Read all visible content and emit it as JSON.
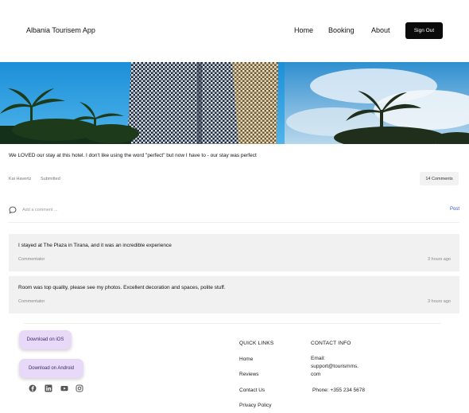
{
  "header": {
    "brand": "Albania Tourisem App",
    "nav": [
      "Home",
      "Booking",
      "About"
    ],
    "sign_out": "Sign Out"
  },
  "review": {
    "text": "We LOVED our stay at this hotel. I don't like using the word \"perfect\" but now I have to - our stay was perfect",
    "author": "Kai Havertz",
    "status": "Submitted",
    "comments_count": "14 Comments"
  },
  "comment_box": {
    "placeholder": "Add a comment ...",
    "post_label": "Post"
  },
  "comments": [
    {
      "body": "I stayed at The Plaza in Tirana, and it was an incredible experience",
      "author": "Commentator",
      "time": "3 hours ago"
    },
    {
      "body": "Room was top quality, please see my photos. Excellent decoration and spaces, polite stuff.",
      "author": "Commentator",
      "time": "3 hours ago"
    }
  ],
  "footer": {
    "ios_button": "Download on iOS",
    "android_button": "Download on  Android",
    "social_icons": [
      "facebook-icon",
      "linkedin-icon",
      "youtube-icon",
      "instagram-icon"
    ],
    "quick_links_title": "QUICK LINKS",
    "quick_links": [
      "Home",
      "Reviews",
      "Contact Us",
      "Privacy Policy"
    ],
    "contact_title": "CONTACT INFO",
    "email_line1": "Email:",
    "email_line2": "support@tourismms.",
    "email_line3": "com",
    "phone": "Phone: +355 234 5678"
  },
  "colors": {
    "accent": "#0b0b0b",
    "post_link": "#3a55c8",
    "store_button": "#e7d9f7",
    "card_bg": "#f1f1f1"
  }
}
